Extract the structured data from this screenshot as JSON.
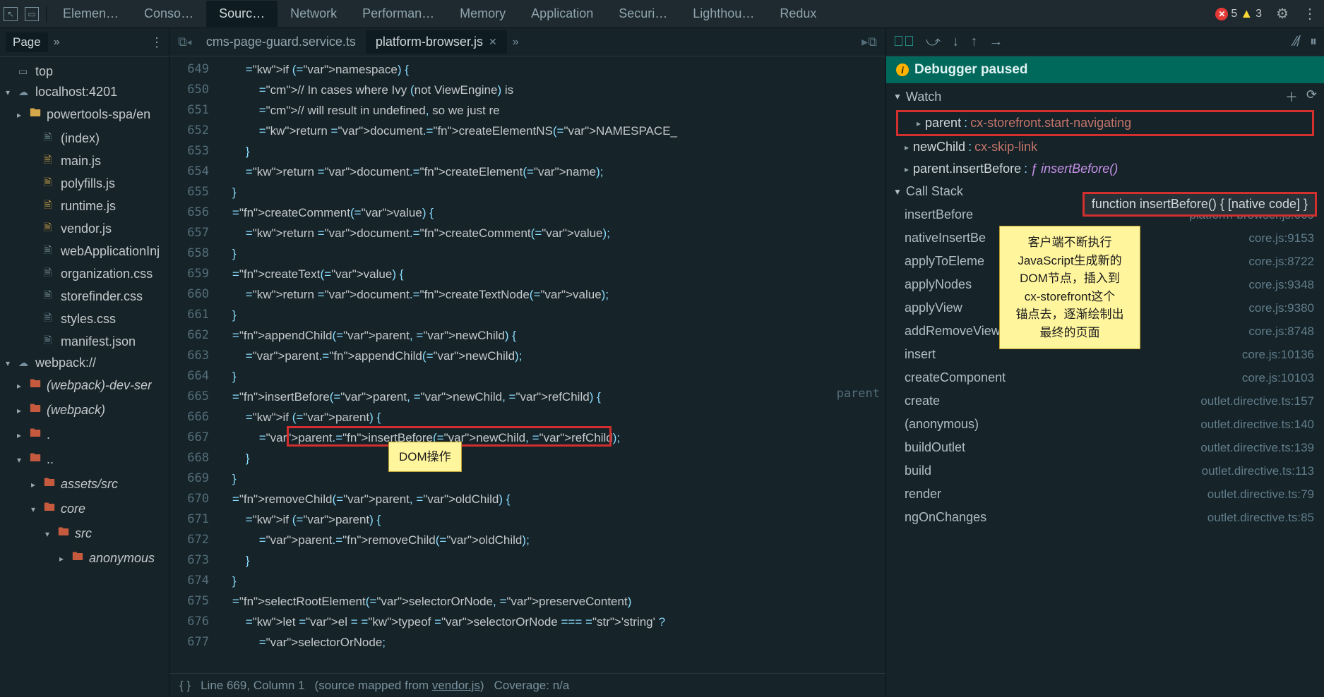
{
  "toolbar": {
    "tabs": [
      "Elemen…",
      "Conso…",
      "Sourc…",
      "Network",
      "Performan…",
      "Memory",
      "Application",
      "Securi…",
      "Lighthou…",
      "Redux"
    ],
    "activeTab": 2,
    "errorCount": "5",
    "warnCount": "3"
  },
  "sidebar": {
    "pageTab": "Page",
    "items": [
      {
        "type": "frame",
        "label": "top",
        "indent": 0,
        "arrow": ""
      },
      {
        "type": "cloud",
        "label": "localhost:4201",
        "indent": 0,
        "arrow": "▾"
      },
      {
        "type": "folder-y",
        "label": "powertools-spa/en",
        "indent": 1,
        "arrow": "▸"
      },
      {
        "type": "file-g",
        "label": "(index)",
        "indent": 2,
        "arrow": ""
      },
      {
        "type": "file-y",
        "label": "main.js",
        "indent": 2,
        "arrow": ""
      },
      {
        "type": "file-y",
        "label": "polyfills.js",
        "indent": 2,
        "arrow": ""
      },
      {
        "type": "file-y",
        "label": "runtime.js",
        "indent": 2,
        "arrow": ""
      },
      {
        "type": "file-y",
        "label": "vendor.js",
        "indent": 2,
        "arrow": ""
      },
      {
        "type": "file-g",
        "label": "webApplicationInj",
        "indent": 2,
        "arrow": ""
      },
      {
        "type": "file-g",
        "label": "organization.css",
        "indent": 2,
        "arrow": ""
      },
      {
        "type": "file-g",
        "label": "storefinder.css",
        "indent": 2,
        "arrow": ""
      },
      {
        "type": "file-g",
        "label": "styles.css",
        "indent": 2,
        "arrow": ""
      },
      {
        "type": "file-g",
        "label": "manifest.json",
        "indent": 2,
        "arrow": ""
      },
      {
        "type": "cloud",
        "label": "webpack://",
        "indent": 0,
        "arrow": "▾"
      },
      {
        "type": "folder-r",
        "label": "(webpack)-dev-ser",
        "indent": 1,
        "arrow": "▸",
        "italic": true
      },
      {
        "type": "folder-r",
        "label": "(webpack)",
        "indent": 1,
        "arrow": "▸",
        "italic": true
      },
      {
        "type": "folder-r",
        "label": ".",
        "indent": 1,
        "arrow": "▸"
      },
      {
        "type": "folder-r",
        "label": "..",
        "indent": 1,
        "arrow": "▾"
      },
      {
        "type": "folder-r",
        "label": "assets/src",
        "indent": 2,
        "arrow": "▸",
        "italic": true
      },
      {
        "type": "folder-r",
        "label": "core",
        "indent": 2,
        "arrow": "▾",
        "italic": true
      },
      {
        "type": "folder-r",
        "label": "src",
        "indent": 3,
        "arrow": "▾",
        "italic": true
      },
      {
        "type": "folder-r",
        "label": "anonymous",
        "indent": 4,
        "arrow": "▸",
        "italic": true
      }
    ]
  },
  "editor": {
    "tabs": [
      {
        "label": "cms-page-guard.service.ts",
        "active": false
      },
      {
        "label": "platform-browser.js",
        "active": true
      }
    ],
    "startLine": 649,
    "endLine": 677,
    "statusLine": "Line 669, Column 1",
    "sourceMapped": "(source mapped from ",
    "sourceMappedFile": "vendor.js",
    "coverage": "Coverage: n/a",
    "annotation": "DOM操作",
    "hint": "parent",
    "code": [
      "        if (namespace) {",
      "            // In cases where Ivy (not ViewEngine) is",
      "            // will result in undefined, so we just re",
      "            return document.createElementNS(NAMESPACE_",
      "        }",
      "        return document.createElement(name);",
      "    }",
      "    createComment(value) {",
      "        return document.createComment(value);",
      "    }",
      "    createText(value) {",
      "        return document.createTextNode(value);",
      "    }",
      "    appendChild(parent, newChild) {",
      "        parent.appendChild(newChild);",
      "    }",
      "    insertBefore(parent, newChild, refChild) {",
      "        if (parent) {",
      "            parent.insertBefore(newChild, refChild);",
      "        }",
      "    }",
      "    removeChild(parent, oldChild) {",
      "        if (parent) {",
      "            parent.removeChild(oldChild);",
      "        }",
      "    }",
      "    selectRootElement(selectorOrNode, preserveContent)",
      "        let el = typeof selectorOrNode === 'string' ?",
      "            selectorOrNode;"
    ]
  },
  "debug": {
    "banner": "Debugger paused",
    "watch": {
      "title": "Watch",
      "items": [
        {
          "name": "parent",
          "value": "cx-storefront.start-navigating",
          "highlight": true
        },
        {
          "name": "newChild",
          "value": "cx-skip-link"
        },
        {
          "name": "parent.insertBefore",
          "fn": "insertBefore()"
        }
      ]
    },
    "nativeCode": "function insertBefore() { [native code] }",
    "callStack": {
      "title": "Call Stack",
      "items": [
        {
          "fn": "insertBefore",
          "loc": "platform-browser.js:669"
        },
        {
          "fn": "nativeInsertBe",
          "loc": "core.js:9153"
        },
        {
          "fn": "applyToEleme",
          "loc": "core.js:8722"
        },
        {
          "fn": "applyNodes",
          "loc": "core.js:9348"
        },
        {
          "fn": "applyView",
          "loc": "core.js:9380"
        },
        {
          "fn": "addRemoveViewFromContainer",
          "loc": "core.js:8748"
        },
        {
          "fn": "insert",
          "loc": "core.js:10136"
        },
        {
          "fn": "createComponent",
          "loc": "core.js:10103"
        },
        {
          "fn": "create",
          "loc": "outlet.directive.ts:157"
        },
        {
          "fn": "(anonymous)",
          "loc": "outlet.directive.ts:140"
        },
        {
          "fn": "buildOutlet",
          "loc": "outlet.directive.ts:139"
        },
        {
          "fn": "build",
          "loc": "outlet.directive.ts:113"
        },
        {
          "fn": "render",
          "loc": "outlet.directive.ts:79"
        },
        {
          "fn": "ngOnChanges",
          "loc": "outlet.directive.ts:85"
        }
      ]
    },
    "tooltip": "客户端不断执行\nJavaScript生成新的\nDOM节点，插入到\ncx-storefront这个\n锚点去，逐渐绘制出\n最终的页面"
  }
}
